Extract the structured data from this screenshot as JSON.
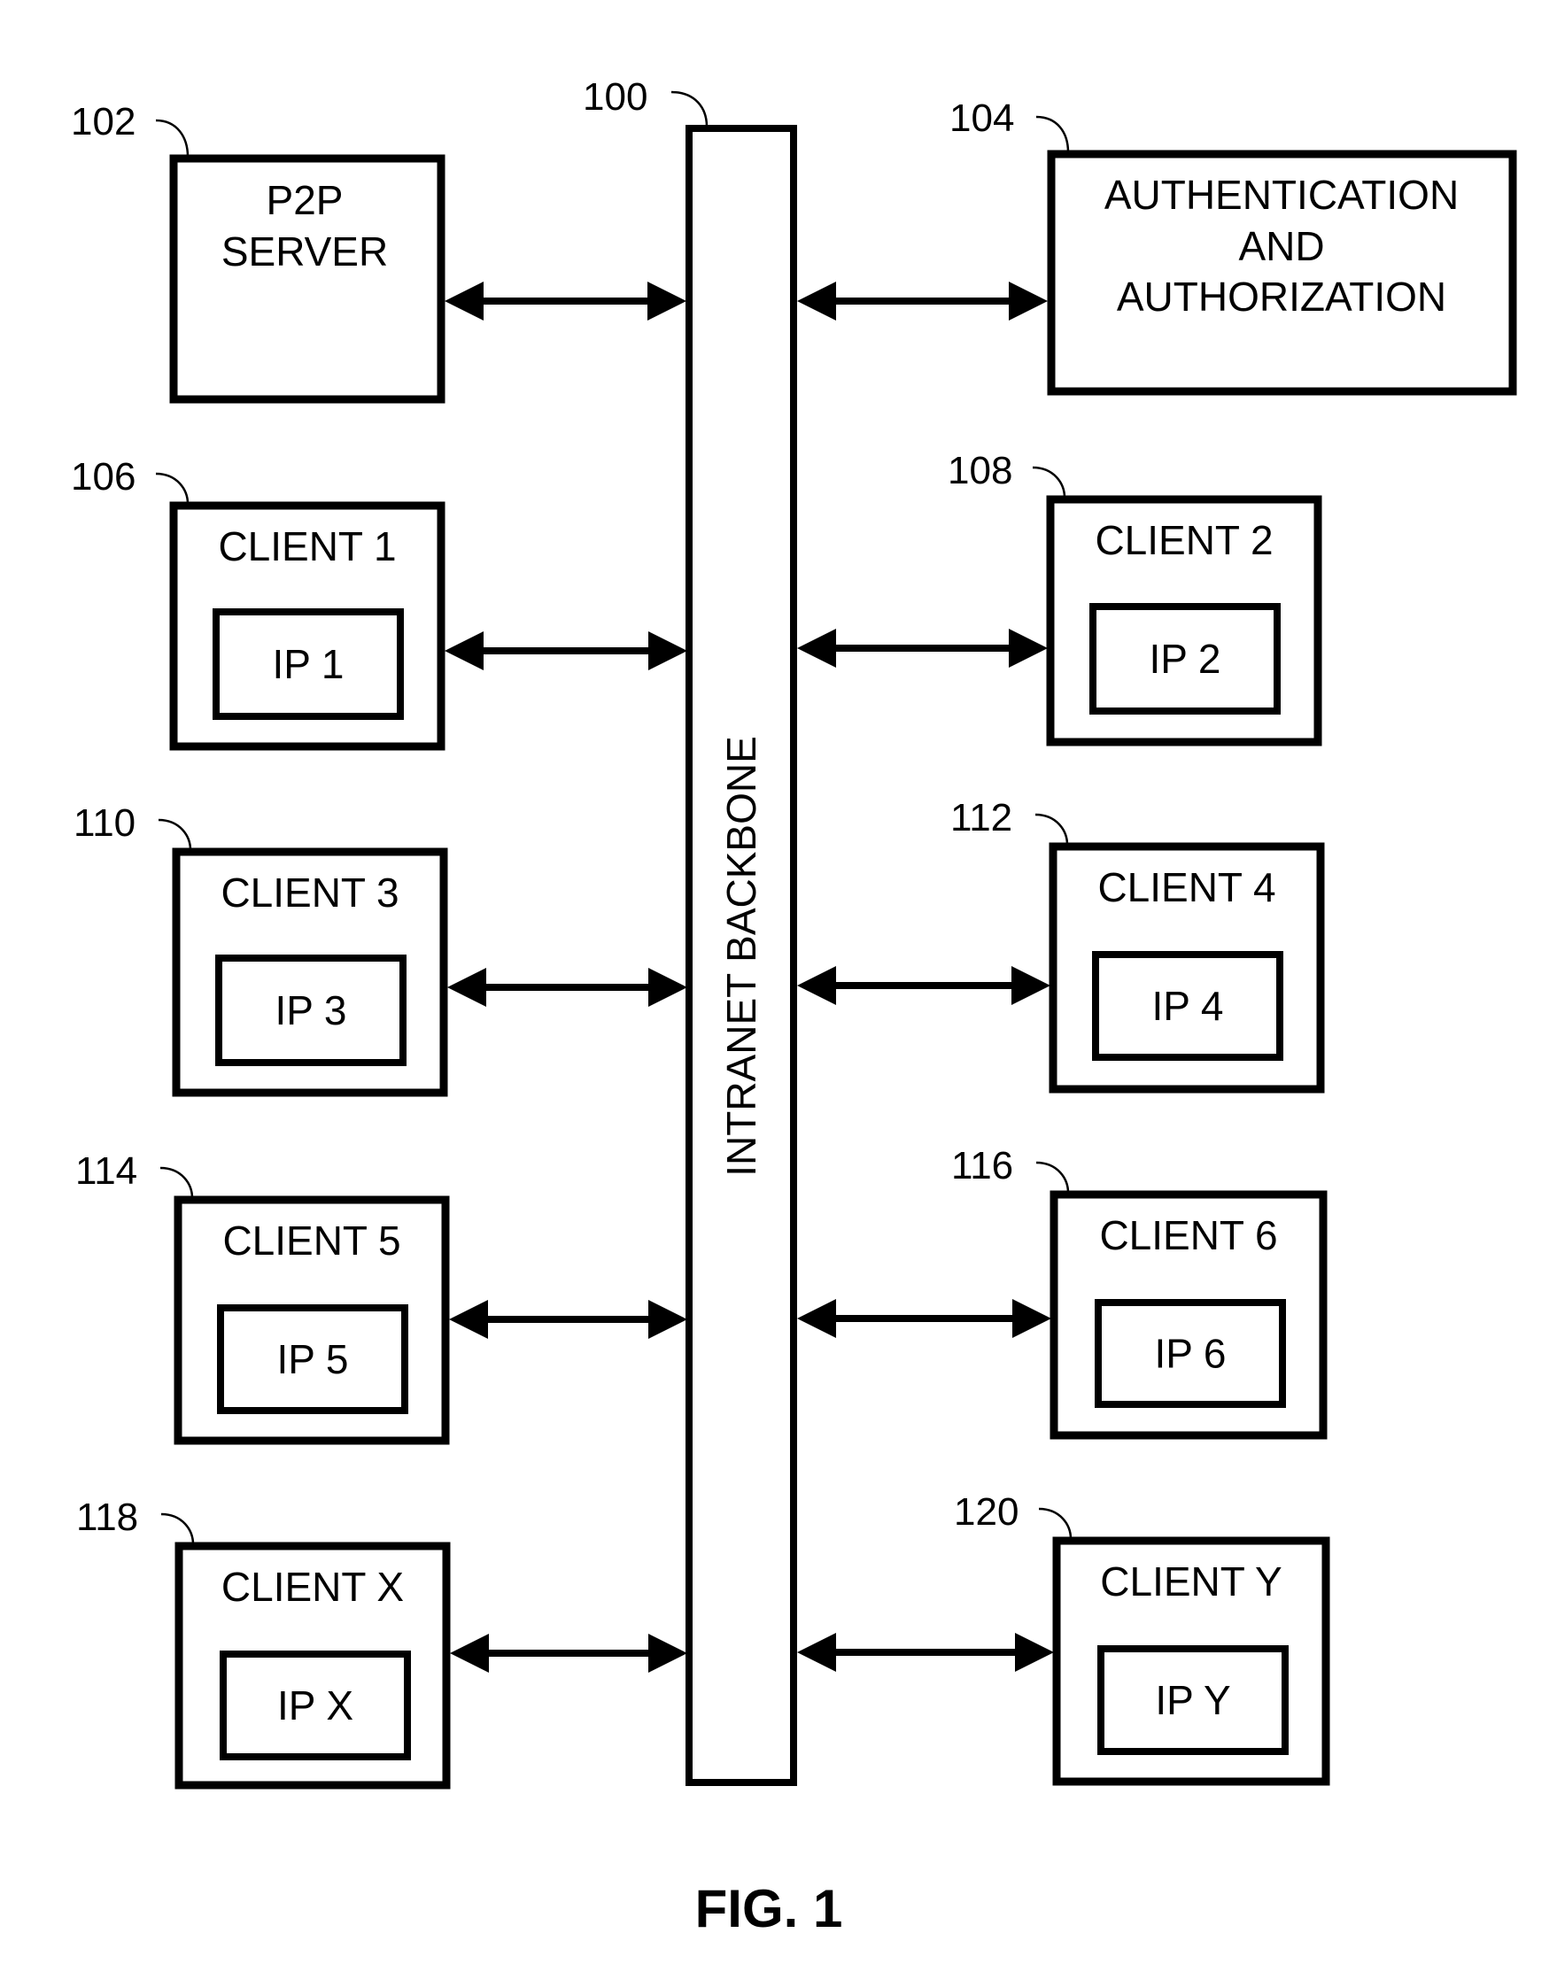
{
  "figure": {
    "caption": "FIG. 1",
    "backbone": {
      "ref": "100",
      "label": "INTRANET BACKBONE"
    },
    "server": {
      "ref": "102",
      "lines": [
        "P2P",
        "SERVER"
      ]
    },
    "auth": {
      "ref": "104",
      "lines": [
        "AUTHENTICATION",
        "AND",
        "AUTHORIZATION"
      ]
    },
    "clients": [
      {
        "ref": "106",
        "name": "CLIENT 1",
        "ip": "IP 1",
        "side": "left"
      },
      {
        "ref": "108",
        "name": "CLIENT 2",
        "ip": "IP 2",
        "side": "right"
      },
      {
        "ref": "110",
        "name": "CLIENT 3",
        "ip": "IP 3",
        "side": "left"
      },
      {
        "ref": "112",
        "name": "CLIENT 4",
        "ip": "IP 4",
        "side": "right"
      },
      {
        "ref": "114",
        "name": "CLIENT 5",
        "ip": "IP 5",
        "side": "left"
      },
      {
        "ref": "116",
        "name": "CLIENT 6",
        "ip": "IP 6",
        "side": "right"
      },
      {
        "ref": "118",
        "name": "CLIENT X",
        "ip": "IP X",
        "side": "left"
      },
      {
        "ref": "120",
        "name": "CLIENT Y",
        "ip": "IP Y",
        "side": "right"
      }
    ],
    "connections": "bidirectional"
  }
}
